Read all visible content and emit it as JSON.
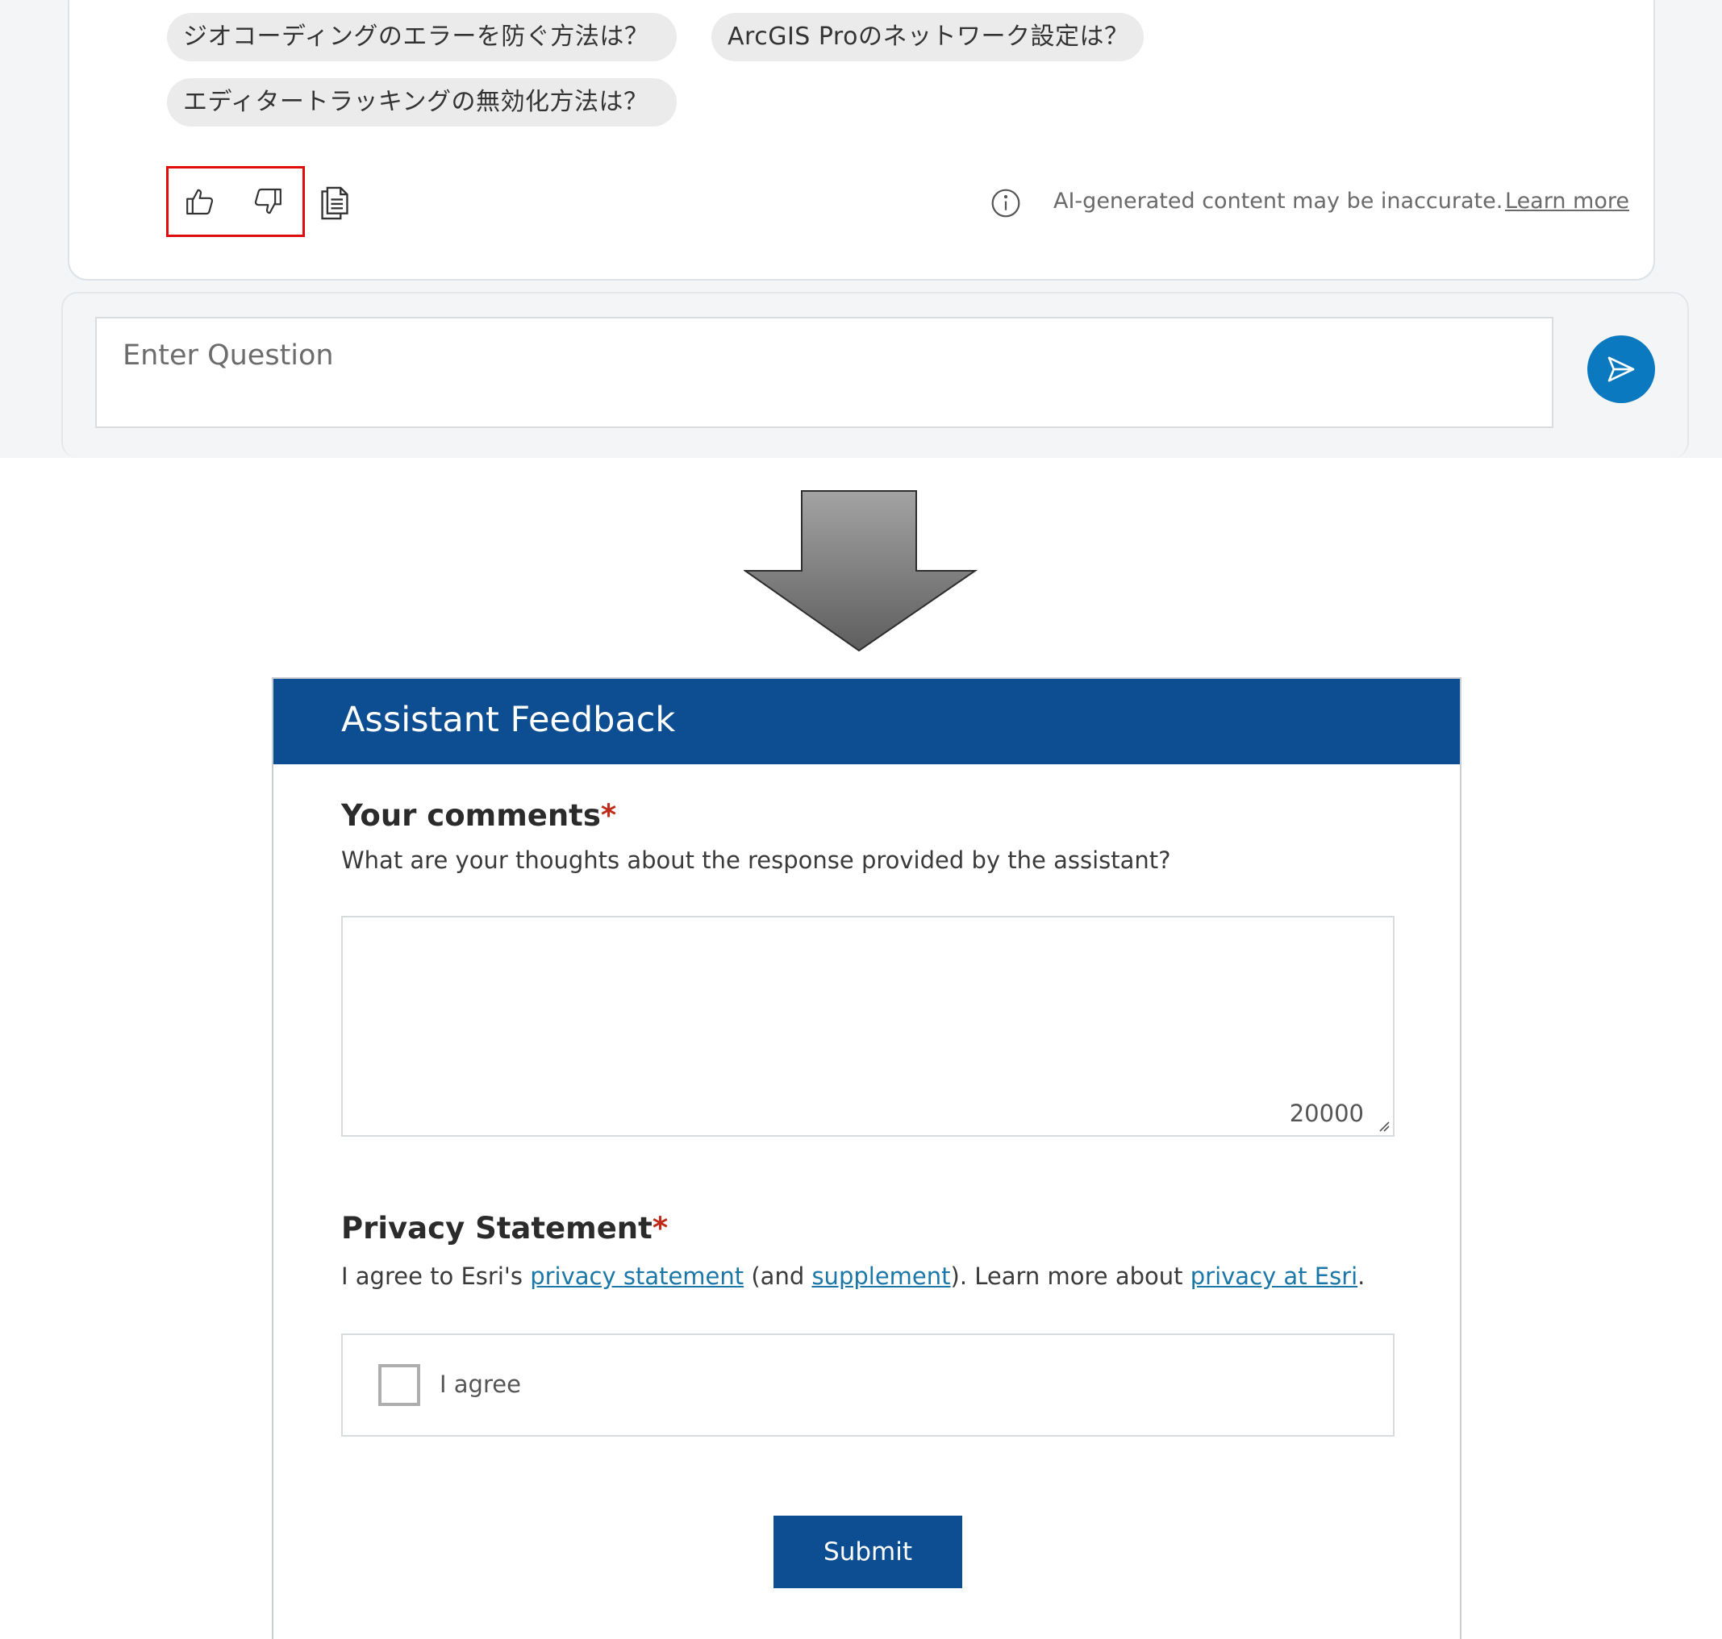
{
  "chat": {
    "suggestions": [
      "ジオコーディングのエラーを防ぐ方法は？",
      "ArcGIS Proのネットワーク設定は？",
      "エディタートラッキングの無効化方法は？"
    ],
    "disclaimer": "AI-generated content may be inaccurate.",
    "learn_more": "Learn more",
    "input_placeholder": "Enter Question"
  },
  "feedback": {
    "title": "Assistant Feedback",
    "comments_title": "Your comments",
    "required_mark": "*",
    "comments_description": "What are your thoughts about the response provided by the assistant?",
    "char_limit": "20000",
    "privacy_title": "Privacy Statement",
    "privacy_prefix": "I agree to Esri's ",
    "privacy_link": "privacy statement",
    "privacy_mid1": " (and ",
    "supplement_link": "supplement",
    "privacy_mid2": "). Learn more about ",
    "privacy_esri_link": "privacy at Esri",
    "privacy_suffix": ".",
    "agree_label": "I agree",
    "submit_label": "Submit"
  },
  "colors": {
    "header_blue": "#0c4e91",
    "send_blue": "#0a79bf",
    "highlight_red": "#e00c0c",
    "required_red": "#c02a18",
    "link_teal": "#1a77a8"
  }
}
